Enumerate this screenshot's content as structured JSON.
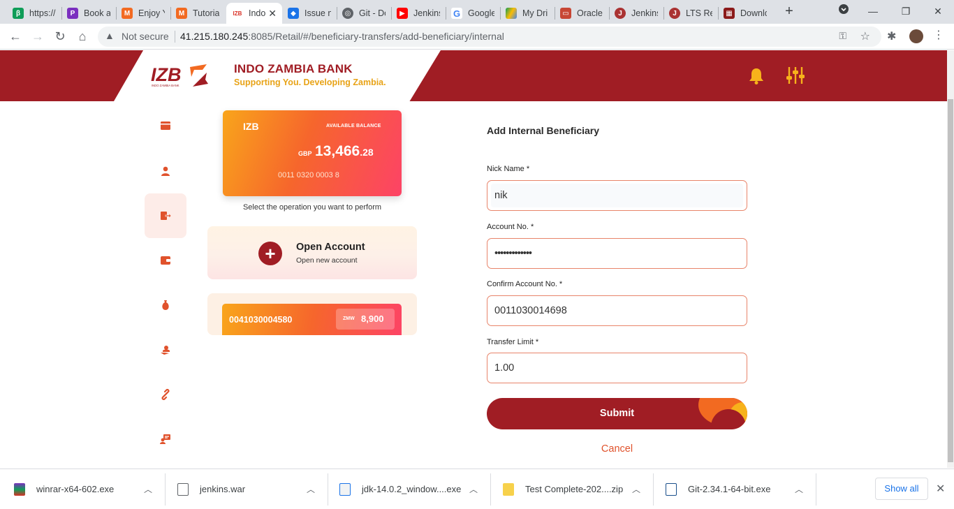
{
  "browser": {
    "tabs": [
      {
        "title": "https://",
        "color": "#0f9d58"
      },
      {
        "title": "Book a",
        "color": "#7b2fbf"
      },
      {
        "title": "Enjoy Y",
        "color": "#f26a21"
      },
      {
        "title": "Tutorial",
        "color": "#f26a21"
      },
      {
        "title": "Indo",
        "color": "#d93025"
      },
      {
        "title": "Issue n",
        "color": "#1a73e8"
      },
      {
        "title": "Git - Do",
        "color": "#5f6368"
      },
      {
        "title": "Jenkins",
        "color": "#ff0000"
      },
      {
        "title": "Google",
        "color": "#4285f4"
      },
      {
        "title": "My Dri",
        "color": "#fbbc04"
      },
      {
        "title": "Oracle",
        "color": "#c74634"
      },
      {
        "title": "Jenkins",
        "color": "#a33"
      },
      {
        "title": "LTS Rel",
        "color": "#a33"
      },
      {
        "title": "Downlo",
        "color": "#8b1a1a"
      }
    ],
    "address": {
      "security": "Not secure",
      "host": "41.215.180.245",
      "path": ":8085/Retail/#/beneficiary-transfers/add-beneficiary/internal"
    }
  },
  "header": {
    "logo_text": "IZB",
    "logo_sub": "INDO ZAMBIA BANK",
    "bank_name": "INDO ZAMBIA BANK",
    "tagline": "Supporting You. Developing Zambia.",
    "accent": "#a01d24"
  },
  "sidenav": [
    {
      "name": "cards",
      "icon": "card-icon"
    },
    {
      "name": "profile",
      "icon": "user-icon"
    },
    {
      "name": "transfers",
      "icon": "transfer-icon",
      "active": true
    },
    {
      "name": "wallet",
      "icon": "wallet-icon"
    },
    {
      "name": "savings",
      "icon": "money-bag-icon"
    },
    {
      "name": "support",
      "icon": "hand-user-icon"
    },
    {
      "name": "links",
      "icon": "link-icon"
    },
    {
      "name": "messages",
      "icon": "chat-icon"
    }
  ],
  "balance_card": {
    "brand": "IZB",
    "label": "AVAILABLE BALANCE",
    "currency": "GBP",
    "amount_main": "13,466",
    "amount_decimal": ".28",
    "account_number": "0011 0320 0003 8"
  },
  "operation_hint": "Select the operation you want to perform",
  "open_account": {
    "title": "Open Account",
    "subtitle": "Open new account"
  },
  "account_card": {
    "number": "0041030004580",
    "currency": "ZMW",
    "balance": "8,900"
  },
  "form": {
    "title": "Add Internal Beneficiary",
    "nick_label": "Nick Name *",
    "nick_value": "nik",
    "account_label": "Account No. *",
    "account_value": "•••••••••••••",
    "confirm_label": "Confirm Account No. *",
    "confirm_value": "0011030014698",
    "limit_label": "Transfer Limit *",
    "limit_value": "1.00",
    "submit": "Submit",
    "cancel": "Cancel"
  },
  "downloads": {
    "items": [
      {
        "name": "winrar-x64-602.exe"
      },
      {
        "name": "jenkins.war"
      },
      {
        "name": "jdk-14.0.2_window....exe"
      },
      {
        "name": "Test Complete-202....zip"
      },
      {
        "name": "Git-2.34.1-64-bit.exe"
      }
    ],
    "show_all": "Show all"
  }
}
